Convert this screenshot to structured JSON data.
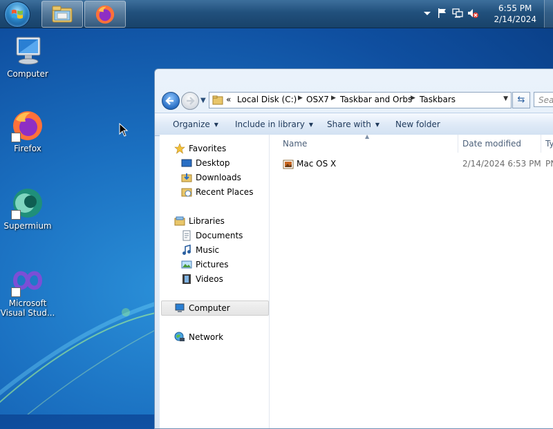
{
  "taskbar": {
    "clock_time": "6:55 PM",
    "clock_date": "2/14/2024",
    "pinned": [
      {
        "icon": "file-explorer-icon"
      },
      {
        "icon": "firefox-icon"
      }
    ],
    "tray_icons": [
      "show-hidden-icons-icon",
      "action-center-flag-icon",
      "network-icon",
      "volume-muted-icon"
    ]
  },
  "desktop": {
    "icons": [
      {
        "label": "Computer",
        "icon": "computer-icon"
      },
      {
        "label": "Firefox",
        "icon": "firefox-icon"
      },
      {
        "label": "Supermium",
        "icon": "supermium-icon"
      },
      {
        "label": "Microsoft Visual Stud...",
        "icon": "visual-studio-icon"
      }
    ]
  },
  "explorer": {
    "breadcrumb_prefix": "«",
    "breadcrumb": [
      "Local Disk (C:)",
      "OSX7",
      "Taskbar and Orbs",
      "Taskbars"
    ],
    "search_placeholder": "Sea",
    "toolbar": {
      "organize": "Organize",
      "include_in_library": "Include in library",
      "share_with": "Share with",
      "new_folder": "New folder"
    },
    "nav": {
      "favorites": "Favorites",
      "desktop": "Desktop",
      "downloads": "Downloads",
      "recent_places": "Recent Places",
      "libraries": "Libraries",
      "documents": "Documents",
      "music": "Music",
      "pictures": "Pictures",
      "videos": "Videos",
      "computer": "Computer",
      "network": "Network"
    },
    "columns": {
      "name": "Name",
      "date_modified": "Date modified",
      "type": "Ty"
    },
    "files": [
      {
        "name": "Mac OS X",
        "date_modified": "2/14/2024 6:53 PM",
        "type": "PN"
      }
    ]
  },
  "colors": {
    "taskbar": "#21507c",
    "desktop_background": "#1a6fc0",
    "window_frame": "#dbe7f5",
    "toolbar_text": "#1e395b"
  }
}
